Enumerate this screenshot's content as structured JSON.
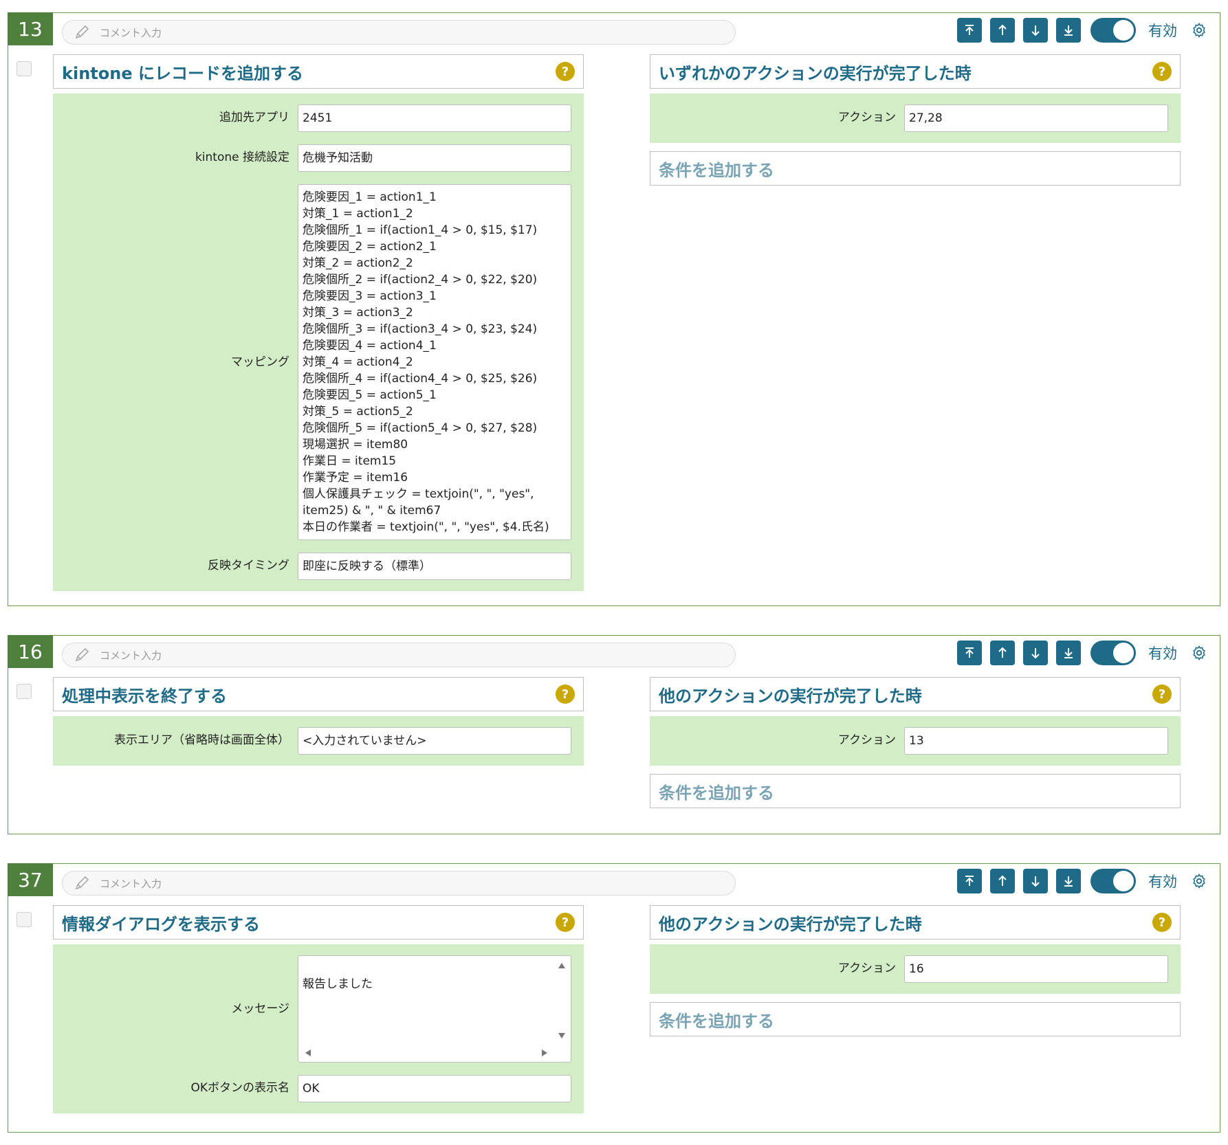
{
  "comment_placeholder": "コメント入力",
  "enabled_label": "有効",
  "help_glyph": "?",
  "add_condition_label": "条件を追加する",
  "colors": {
    "accent": "#1f6b87",
    "number_bg": "#4f7f3d",
    "panel_bg": "#d3edc6",
    "border": "#6b9a4e",
    "help": "#c9a800"
  },
  "blocks": [
    {
      "number": "13",
      "action": {
        "title": "kintone にレコードを追加する",
        "fields": {
          "target_app_label": "追加先アプリ",
          "target_app_value": "2451",
          "connection_label": "kintone 接続設定",
          "connection_value": "危機予知活動",
          "mapping_label": "マッピング",
          "mapping_value": "危険要因_1 = action1_1\n対策_1 = action1_2\n危険個所_1 = if(action1_4 > 0, $15, $17)\n危険要因_2 = action2_1\n対策_2 = action2_2\n危険個所_2 = if(action2_4 > 0, $22, $20)\n危険要因_3 = action3_1\n対策_3 = action3_2\n危険個所_3 = if(action3_4 > 0, $23, $24)\n危険要因_4 = action4_1\n対策_4 = action4_2\n危険個所_4 = if(action4_4 > 0, $25, $26)\n危険要因_5 = action5_1\n対策_5 = action5_2\n危険個所_5 = if(action5_4 > 0, $27, $28)\n現場選択 = item80\n作業日 = item15\n作業予定 = item16\n個人保護具チェック = textjoin(\", \", \"yes\",\nitem25) & \", \" & item67\n本日の作業者 = textjoin(\", \", \"yes\", $4.氏名)",
          "timing_label": "反映タイミング",
          "timing_value": "即座に反映する（標準）"
        }
      },
      "trigger": {
        "title": "いずれかのアクションの実行が完了した時",
        "action_label": "アクション",
        "action_value": "27,28"
      }
    },
    {
      "number": "16",
      "action": {
        "title": "処理中表示を終了する",
        "fields": {
          "area_label": "表示エリア（省略時は画面全体）",
          "area_value": "<入力されていません>"
        }
      },
      "trigger": {
        "title": "他のアクションの実行が完了した時",
        "action_label": "アクション",
        "action_value": "13"
      }
    },
    {
      "number": "37",
      "action": {
        "title": "情報ダイアログを表示する",
        "fields": {
          "message_label": "メッセージ",
          "message_value": "報告しました",
          "ok_label": "OKボタンの表示名",
          "ok_value": "OK"
        }
      },
      "trigger": {
        "title": "他のアクションの実行が完了した時",
        "action_label": "アクション",
        "action_value": "16"
      }
    }
  ]
}
